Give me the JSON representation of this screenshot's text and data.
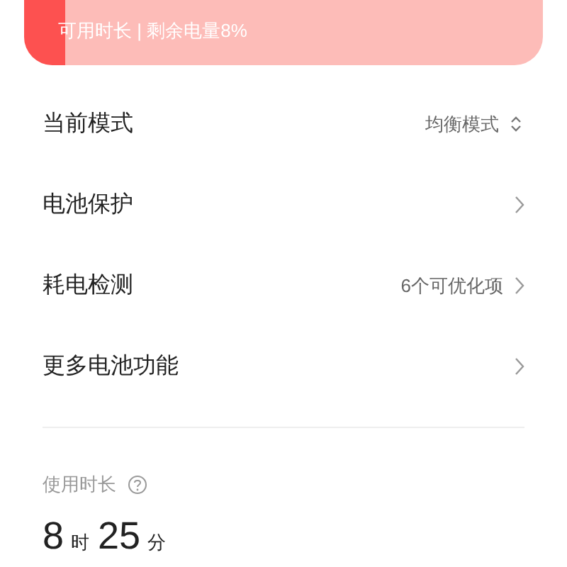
{
  "battery": {
    "summary": "可用时长 | 剩余电量8%",
    "level": 0.08
  },
  "settings": [
    {
      "label": "当前模式",
      "value": "均衡模式",
      "kind": "select"
    },
    {
      "label": "电池保护",
      "kind": "link"
    },
    {
      "label": "耗电检测",
      "value": "6个可优化项",
      "kind": "link"
    },
    {
      "label": "更多电池功能",
      "kind": "link"
    }
  ],
  "usage": {
    "title": "使用时长",
    "hours": "8",
    "hours_unit": "时",
    "minutes": "25",
    "minutes_unit": "分"
  }
}
